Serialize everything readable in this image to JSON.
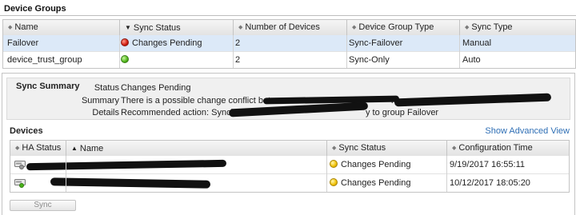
{
  "device_groups": {
    "title": "Device Groups",
    "columns": [
      "Name",
      "Sync Status",
      "Number of Devices",
      "Device Group Type",
      "Sync Type"
    ],
    "rows": [
      {
        "name": "Failover",
        "sync_status": "Changes Pending",
        "status_color": "red",
        "devices": "2",
        "group_type": "Sync-Failover",
        "sync_type": "Manual"
      },
      {
        "name": "device_trust_group",
        "sync_status": "",
        "status_color": "green",
        "devices": "2",
        "group_type": "Sync-Only",
        "sync_type": "Auto"
      }
    ]
  },
  "sync_summary": {
    "title": "Sync Summary",
    "status_label": "Status",
    "status_value": "Changes Pending",
    "summary_label": "Summary",
    "summary_value": "There is a possible change conflict betwee",
    "summary_tail": "n",
    "details_label": "Details",
    "details_value": "Recommended action: Synchronize",
    "details_tail": "y to group Failover"
  },
  "devices": {
    "title": "Devices",
    "advanced_link": "Show Advanced View",
    "columns": [
      "HA Status",
      "Name",
      "Sync Status",
      "Configuration Time"
    ],
    "rows": [
      {
        "sync_status": "Changes Pending",
        "config_time": "9/19/2017 16:55:11"
      },
      {
        "sync_status": "Changes Pending",
        "config_time": "10/12/2017 18:05:20"
      }
    ]
  },
  "footer": {
    "sync_button": "Sync"
  },
  "colors": {
    "selected_row": "#dce9f8",
    "link": "#2f6fb5",
    "redaction": "#111111"
  }
}
